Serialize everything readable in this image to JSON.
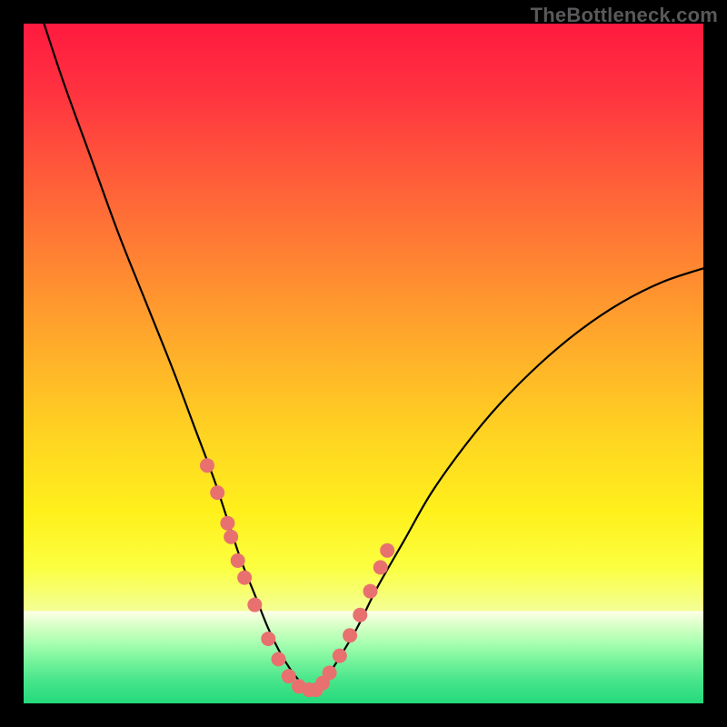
{
  "watermark": "TheBottleneck.com",
  "gradient": {
    "stops": [
      {
        "offset": 0.0,
        "color": "#ff1a3f"
      },
      {
        "offset": 0.1,
        "color": "#ff3240"
      },
      {
        "offset": 0.22,
        "color": "#ff5a3a"
      },
      {
        "offset": 0.35,
        "color": "#ff8432"
      },
      {
        "offset": 0.48,
        "color": "#ffae2a"
      },
      {
        "offset": 0.6,
        "color": "#ffd222"
      },
      {
        "offset": 0.72,
        "color": "#fff11c"
      },
      {
        "offset": 0.8,
        "color": "#fbff40"
      },
      {
        "offset": 0.86,
        "color": "#f4ff90"
      }
    ]
  },
  "green_band": {
    "top_frac": 0.864,
    "stops": [
      {
        "offset": 0.0,
        "color": "#feffe6"
      },
      {
        "offset": 0.15,
        "color": "#d9ffc8"
      },
      {
        "offset": 0.35,
        "color": "#a7ffb0"
      },
      {
        "offset": 0.55,
        "color": "#74f39b"
      },
      {
        "offset": 0.75,
        "color": "#48e58b"
      },
      {
        "offset": 1.0,
        "color": "#24d97b"
      }
    ]
  },
  "chart_data": {
    "type": "line",
    "title": "",
    "xlabel": "",
    "ylabel": "",
    "x_range": [
      0,
      100
    ],
    "y_range": [
      0,
      100
    ],
    "series": [
      {
        "name": "bottleneck-curve",
        "x": [
          3,
          6,
          10,
          14,
          18,
          22,
          25,
          28,
          30,
          32,
          34,
          36,
          38,
          40,
          42,
          44,
          46,
          49,
          52,
          56,
          60,
          65,
          70,
          76,
          82,
          88,
          94,
          100
        ],
        "y": [
          100,
          91,
          80,
          69,
          59,
          49,
          41,
          33,
          27,
          21,
          16,
          11,
          7,
          4,
          2,
          3,
          6,
          11,
          17,
          24,
          31,
          38,
          44,
          50,
          55,
          59,
          62,
          64
        ]
      }
    ],
    "scatter": {
      "name": "sample-points",
      "color": "#e8716f",
      "radius_px": 8,
      "x": [
        27,
        28.5,
        30,
        30.5,
        31.5,
        32.5,
        34,
        36,
        37.5,
        39,
        40.5,
        42,
        43,
        44,
        45,
        46.5,
        48,
        49.5,
        51,
        52.5,
        53.5
      ],
      "y": [
        35,
        31,
        26.5,
        24.5,
        21,
        18.5,
        14.5,
        9.5,
        6.5,
        4,
        2.5,
        2,
        2,
        3,
        4.5,
        7,
        10,
        13,
        16.5,
        20,
        22.5
      ]
    }
  }
}
